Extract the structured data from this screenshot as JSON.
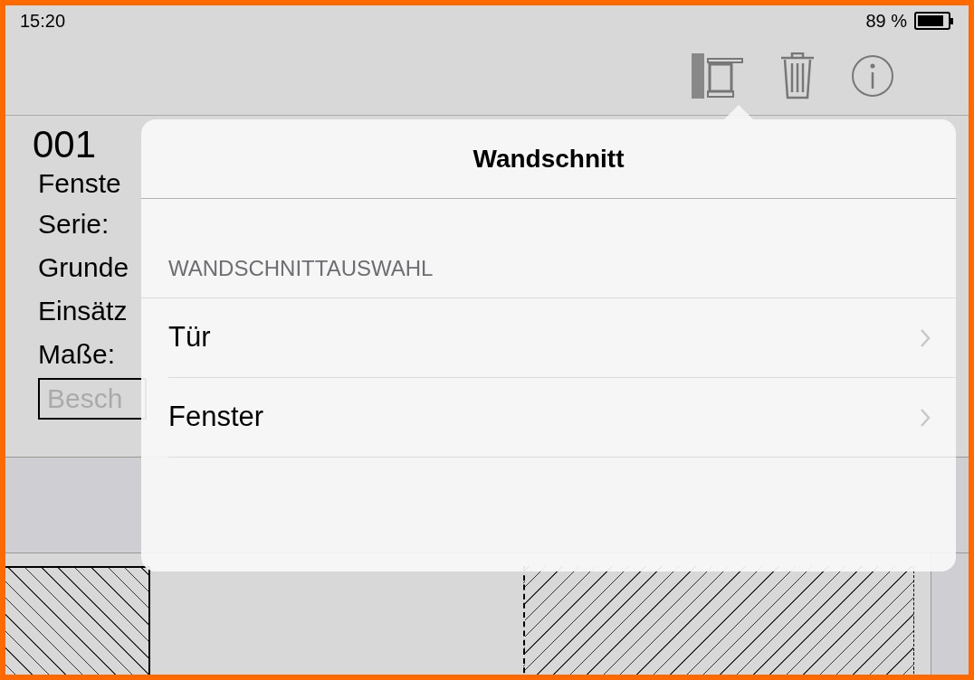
{
  "status_bar": {
    "time": "15:20",
    "battery_text": "89 %"
  },
  "element": {
    "number": "001",
    "name": "Fenste",
    "rows": [
      {
        "label": "Serie:"
      },
      {
        "label": "Grunde"
      },
      {
        "label": "Einsätz"
      },
      {
        "label": "Maße:"
      }
    ],
    "description_placeholder": "Besch"
  },
  "popover": {
    "title": "Wandschnitt",
    "section_header": "WANDSCHNITTAUSWAHL",
    "items": [
      {
        "label": "Tür"
      },
      {
        "label": "Fenster"
      }
    ]
  }
}
